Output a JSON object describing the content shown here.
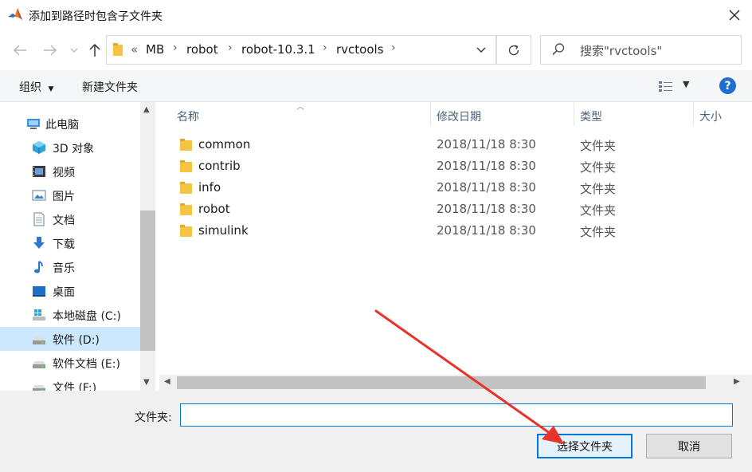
{
  "window": {
    "title": "添加到路径时包含子文件夹"
  },
  "address_bar": {
    "overflow": "«",
    "breadcrumbs": [
      "MB",
      "robot",
      "robot-10.3.1",
      "rvctools"
    ]
  },
  "search": {
    "placeholder": "搜索\"rvctools\""
  },
  "toolbar": {
    "organize": "组织",
    "new_folder": "新建文件夹"
  },
  "sidebar": {
    "items": [
      {
        "label": "此电脑",
        "icon": "computer-icon"
      },
      {
        "label": "3D 对象",
        "icon": "cube-icon"
      },
      {
        "label": "视频",
        "icon": "video-icon"
      },
      {
        "label": "图片",
        "icon": "picture-icon"
      },
      {
        "label": "文档",
        "icon": "document-icon"
      },
      {
        "label": "下载",
        "icon": "download-icon"
      },
      {
        "label": "音乐",
        "icon": "music-icon"
      },
      {
        "label": "桌面",
        "icon": "desktop-icon"
      },
      {
        "label": "本地磁盘 (C:)",
        "icon": "windows-drive-icon"
      },
      {
        "label": "软件 (D:)",
        "icon": "drive-icon",
        "selected": true
      },
      {
        "label": "软件文档 (E:)",
        "icon": "drive-icon"
      },
      {
        "label": "文件 (F:)",
        "icon": "drive-icon"
      }
    ]
  },
  "file_list": {
    "columns": [
      "名称",
      "修改日期",
      "类型",
      "大小"
    ],
    "rows": [
      {
        "name": "common",
        "date": "2018/11/18 8:30",
        "type": "文件夹"
      },
      {
        "name": "contrib",
        "date": "2018/11/18 8:30",
        "type": "文件夹"
      },
      {
        "name": "info",
        "date": "2018/11/18 8:30",
        "type": "文件夹"
      },
      {
        "name": "robot",
        "date": "2018/11/18 8:30",
        "type": "文件夹"
      },
      {
        "name": "simulink",
        "date": "2018/11/18 8:30",
        "type": "文件夹"
      }
    ]
  },
  "footer": {
    "folder_label": "文件夹:",
    "folder_value": "",
    "select_button": "选择文件夹",
    "cancel_button": "取消"
  },
  "colors": {
    "accent": "#0078d7",
    "selection": "#cce8ff",
    "folder": "#f5c542",
    "annotation_arrow": "#e8332a"
  }
}
